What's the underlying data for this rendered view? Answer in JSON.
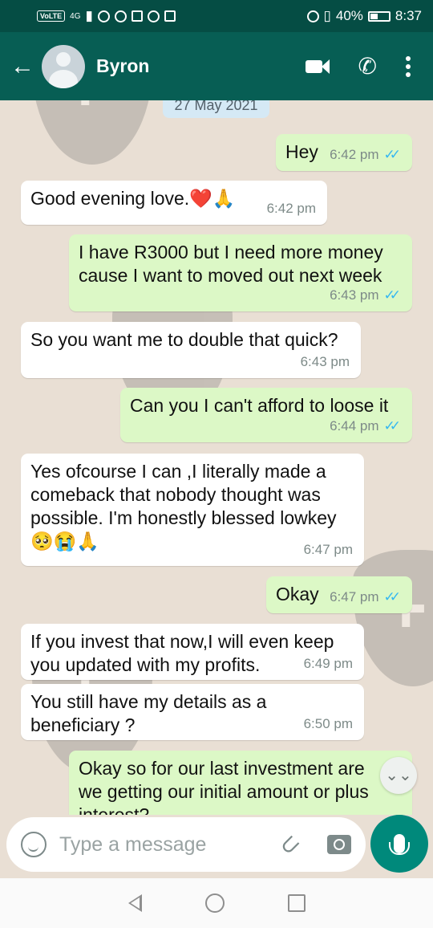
{
  "status_bar": {
    "volte": "VoLTE",
    "network": "4G",
    "battery_percent": "40%",
    "battery_level": 0.4,
    "time": "8:37"
  },
  "header": {
    "contact_name": "Byron",
    "icons": [
      "back-arrow-icon",
      "avatar",
      "video-call-icon",
      "phone-call-icon",
      "more-options-icon"
    ]
  },
  "chat": {
    "date_label": "27 May 2021",
    "messages": [
      {
        "direction": "out",
        "text": "Hey",
        "time": "6:42 pm",
        "status": "read"
      },
      {
        "direction": "in",
        "text": "Good evening love.❤️🙏",
        "time": "6:42 pm"
      },
      {
        "direction": "out",
        "text": "I have R3000 but I need more money cause I want to moved out next week",
        "time": "6:43 pm",
        "status": "read"
      },
      {
        "direction": "in",
        "text": "So you want me to double that quick?",
        "time": "6:43 pm"
      },
      {
        "direction": "out",
        "text": "Can you I can't afford to loose it",
        "time": "6:44 pm",
        "status": "read"
      },
      {
        "direction": "in",
        "text": "Yes ofcourse I can ,I literally made a comeback that nobody thought was possible.  I'm honestly blessed lowkey🥺😭🙏",
        "time": "6:47 pm"
      },
      {
        "direction": "out",
        "text": "Okay",
        "time": "6:47 pm",
        "status": "read"
      },
      {
        "direction": "in",
        "text": "If you invest that now,I will even keep you updated with my profits.",
        "time": "6:49 pm"
      },
      {
        "direction": "in",
        "text": "You still have my details as a beneficiary ?",
        "time": "6:50 pm"
      },
      {
        "direction": "out",
        "text": "Okay so for our last investment are we getting our initial amount or plus interest?",
        "time": "",
        "status": ""
      }
    ],
    "tick_glyph": "✓✓",
    "scroll_down_glyph": "⌄⌄"
  },
  "input_bar": {
    "placeholder": "Type a message"
  },
  "colors": {
    "header": "#075e54",
    "status_bar": "#054d44",
    "outgoing_bubble": "#dcf8c6",
    "incoming_bubble": "#ffffff",
    "read_ticks": "#34b7f1",
    "mic_button": "#00897b"
  }
}
